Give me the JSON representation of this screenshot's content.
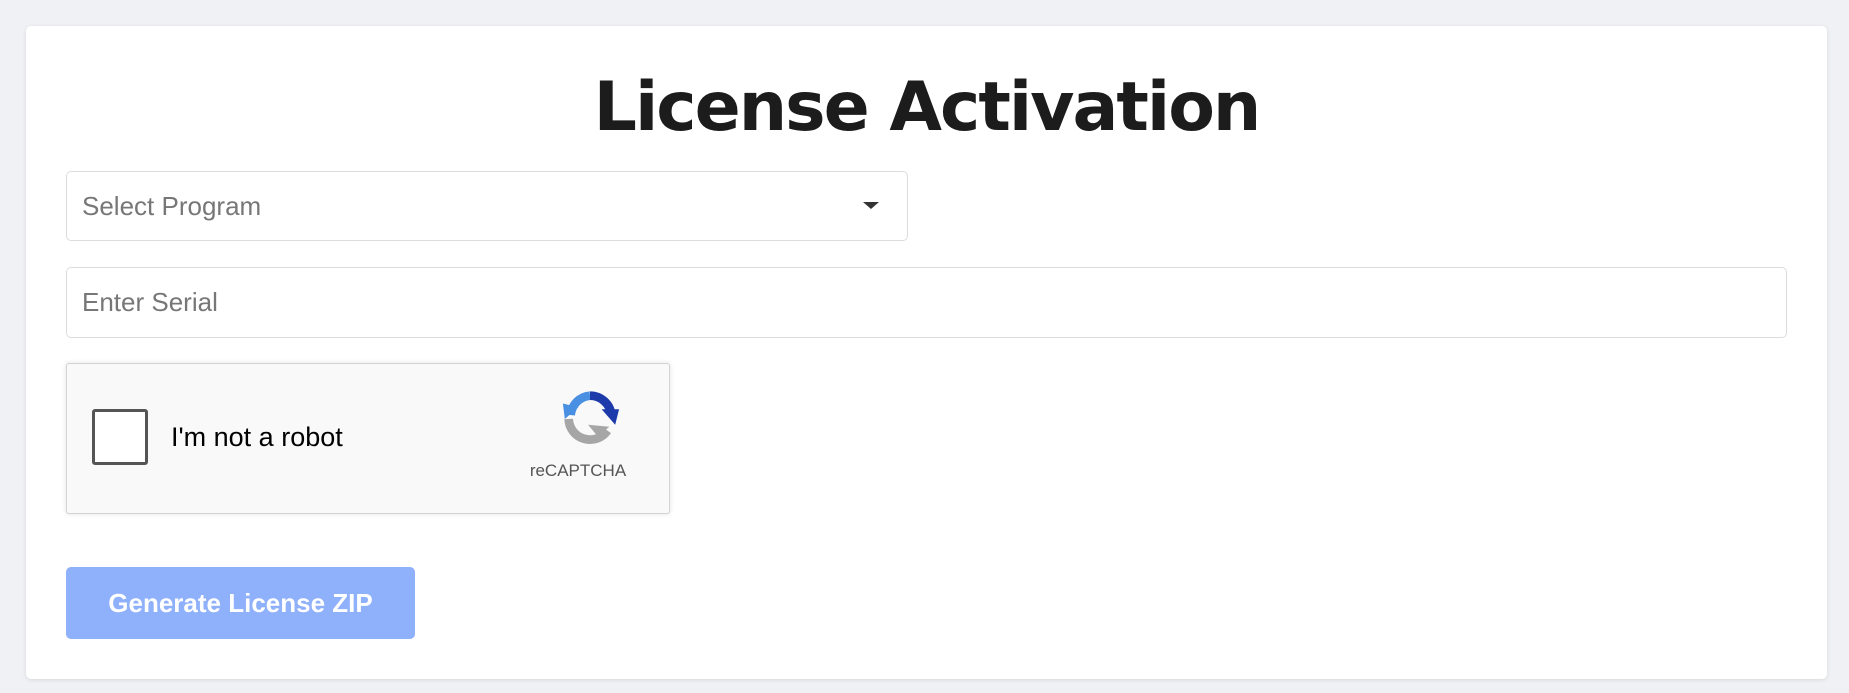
{
  "page": {
    "title": "License Activation"
  },
  "program_select": {
    "placeholder": "Select Program",
    "icon": "caret-down-icon"
  },
  "serial_input": {
    "placeholder": "Enter Serial",
    "value": ""
  },
  "recaptcha": {
    "label": "I'm not a robot",
    "brand": "reCAPTCHA",
    "checked": false,
    "icon": "recaptcha-logo-icon"
  },
  "actions": {
    "generate_label": "Generate License ZIP",
    "disabled": true
  },
  "colors": {
    "page_background": "#eff1f5",
    "card_background": "#ffffff",
    "button_background": "#8fb0fa",
    "button_text": "#ffffff",
    "title_text": "#1c1c1c"
  }
}
